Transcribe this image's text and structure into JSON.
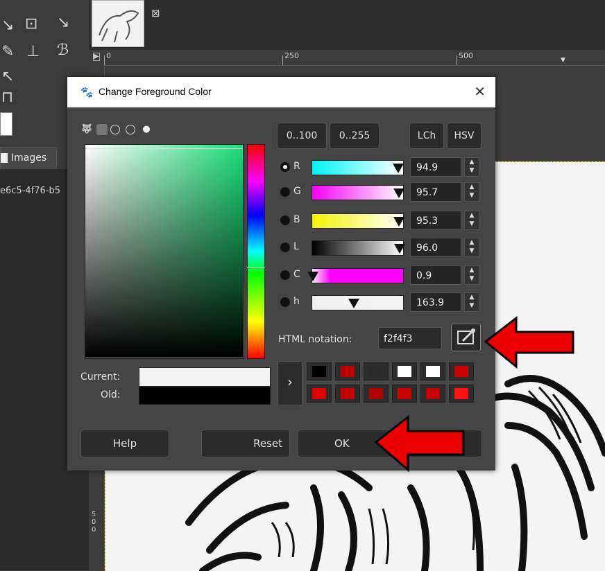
{
  "panel": {
    "tab_label": "Images",
    "image_id": "e6c5-4f76-b5"
  },
  "ruler": {
    "top_marks": [
      "0",
      "250",
      "500"
    ],
    "left_label": "5\n0\n0"
  },
  "dialog": {
    "title": "Change Foreground Color",
    "scale_buttons": [
      "0..100",
      "0..255"
    ],
    "model_buttons": [
      "LCh",
      "HSV"
    ],
    "channels": [
      {
        "label": "R",
        "value": "94.9",
        "selected": true,
        "level": 0.949,
        "gradient": "linear-gradient(to right,#00f4f3,#fff)"
      },
      {
        "label": "G",
        "value": "95.7",
        "selected": false,
        "level": 0.957,
        "gradient": "linear-gradient(to right,#f200f3,#fff)"
      },
      {
        "label": "B",
        "value": "95.3",
        "selected": false,
        "level": 0.953,
        "gradient": "linear-gradient(to right,#f2f400,#fff)"
      },
      {
        "label": "L",
        "value": "96.0",
        "selected": false,
        "level": 0.96,
        "gradient": "linear-gradient(to right,#000,#fff)"
      },
      {
        "label": "C",
        "value": "0.9",
        "selected": false,
        "level": 0.009,
        "gradient": "linear-gradient(to right,#f2f4f3,#ff00ff 20%,#ff00ff)"
      },
      {
        "label": "h",
        "value": "163.9",
        "selected": false,
        "level": 0.455,
        "gradient": "linear-gradient(to right,#f0f0f0,#f2f4f3)"
      }
    ],
    "html_notation_label": "HTML notation:",
    "html_notation_value": "f2f4f3",
    "current_label": "Current:",
    "old_label": "Old:",
    "current_color": "#f2f4f3",
    "old_color": "#000000",
    "history_colors": [
      "#000000",
      "#c00000",
      "#2a2a2a",
      "#ffffff",
      "#ffffff",
      "#cc0000",
      "#e00000",
      "#c80000",
      "#b00000",
      "#d00000",
      "#c40000",
      "#ff1010"
    ],
    "buttons": {
      "help": "Help",
      "reset": "Reset",
      "ok": "OK"
    }
  }
}
